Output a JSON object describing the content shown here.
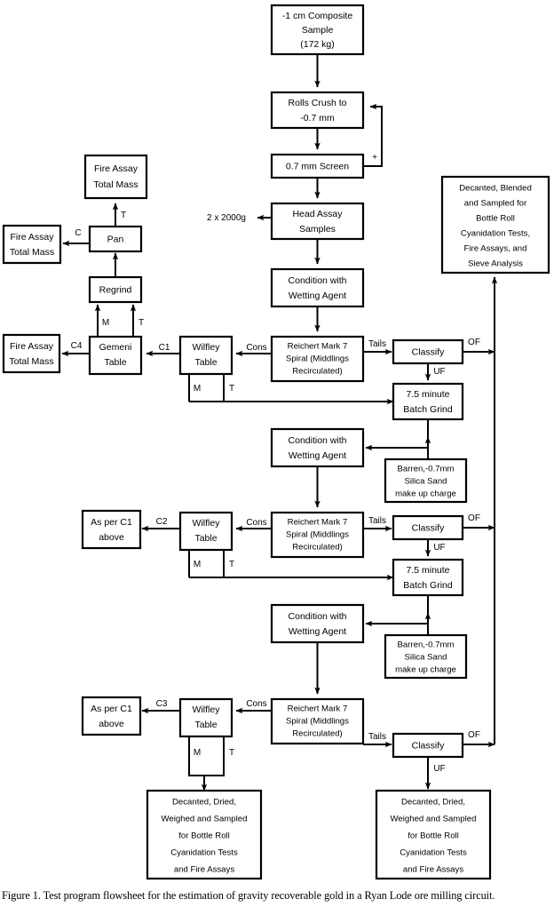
{
  "figure": {
    "caption": "Figure 1.  Test program flowsheet for the estimation of gravity recoverable gold in a Ryan Lode ore milling circuit.",
    "caption_number": "Figure 1.",
    "title": "Test program flowsheet for the estimation of gravity recoverable gold in a Ryan Lode ore milling circuit."
  },
  "nodes": {
    "composite_sample": {
      "lines": [
        "-1 cm Composite",
        "Sample",
        "(172  kg)"
      ]
    },
    "rolls_crush": {
      "lines": [
        "Rolls Crush to",
        "-0.7  mm"
      ]
    },
    "screen": {
      "lines": [
        "0.7 mm Screen"
      ]
    },
    "head_assay": {
      "lines": [
        "Head Assay",
        "Samples"
      ]
    },
    "condition_1": {
      "lines": [
        "Condition with",
        "Wetting Agent"
      ]
    },
    "spiral_1": {
      "lines": [
        "Reichert Mark 7",
        "Spiral (Middlings",
        "Recirculated)"
      ]
    },
    "wilfley_1": {
      "lines": [
        "Wilfley",
        "Table"
      ]
    },
    "gemeni": {
      "lines": [
        "Gemeni",
        "Table"
      ]
    },
    "regrind": {
      "lines": [
        "Regrind"
      ]
    },
    "pan": {
      "lines": [
        "Pan"
      ]
    },
    "fire_assay_top": {
      "lines": [
        "Fire Assay",
        "Total Mass"
      ]
    },
    "fire_assay_left": {
      "lines": [
        "Fire Assay",
        "Total Mass"
      ]
    },
    "fire_assay_c4": {
      "lines": [
        "Fire Assay",
        "Total Mass"
      ]
    },
    "classify_1": {
      "lines": [
        "Classify"
      ]
    },
    "batch_grind_1": {
      "lines": [
        "7.5 minute",
        "Batch Grind"
      ]
    },
    "silica_1": {
      "lines": [
        "Barren,-0.7mm",
        "Silica Sand",
        "make up charge"
      ]
    },
    "condition_2": {
      "lines": [
        "Condition with",
        "Wetting Agent"
      ]
    },
    "spiral_2": {
      "lines": [
        "Reichert Mark 7",
        "Spiral (Middlings",
        "Recirculated)"
      ]
    },
    "wilfley_2": {
      "lines": [
        "Wilfley",
        "Table"
      ]
    },
    "as_per_c1_2": {
      "lines": [
        "As per C1",
        "above"
      ]
    },
    "classify_2": {
      "lines": [
        "Classify"
      ]
    },
    "batch_grind_2": {
      "lines": [
        "7.5 minute",
        "Batch Grind"
      ]
    },
    "silica_2": {
      "lines": [
        "Barren,-0.7mm",
        "Silica Sand",
        "make up charge"
      ]
    },
    "condition_3": {
      "lines": [
        "Condition with",
        "Wetting Agent"
      ]
    },
    "spiral_3": {
      "lines": [
        "Reichert Mark 7",
        "Spiral (Middlings",
        "Recirculated)"
      ]
    },
    "wilfley_3": {
      "lines": [
        "Wilfley",
        "Table"
      ]
    },
    "as_per_c1_3": {
      "lines": [
        "As per C1",
        "above"
      ]
    },
    "classify_3": {
      "lines": [
        "Classify"
      ]
    },
    "decanted_blended": {
      "lines": [
        "Decanted, Blended",
        "and Sampled for",
        "Bottle Roll",
        "Cyanidation Tests,",
        "Fire Assays, and",
        "Sieve Analysis"
      ]
    },
    "decanted_dried_left": {
      "lines": [
        "Decanted,  Dried,",
        "Weighed and Sampled",
        "for Bottle Roll",
        "Cyanidation Tests",
        "and Fire Assays"
      ]
    },
    "decanted_dried_right": {
      "lines": [
        "Decanted,  Dried,",
        "Weighed and Sampled",
        "for Bottle Roll",
        "Cyanidation Tests",
        "and Fire Assays"
      ]
    }
  },
  "edge_labels": {
    "oversize_plus": "+",
    "split_2x2000g": "2 x 2000g",
    "tails_1": "Tails",
    "tails_2": "Tails",
    "tails_3": "Tails",
    "cons_1": "Cons",
    "cons_2": "Cons",
    "cons_3": "Cons",
    "c1": "C1",
    "c2": "C2",
    "c3": "C3",
    "c4": "C4",
    "c_pan": "C",
    "t_pan": "T",
    "m_gemeni": "M",
    "t_gemeni": "T",
    "m_wilfley1": "M",
    "t_wilfley1": "T",
    "m_wilfley2": "M",
    "t_wilfley2": "T",
    "m_wilfley3": "M",
    "t_wilfley3": "T",
    "of_1": "OF",
    "uf_1": "UF",
    "of_2": "OF",
    "uf_2": "UF",
    "of_3": "OF",
    "uf_3": "UF"
  }
}
